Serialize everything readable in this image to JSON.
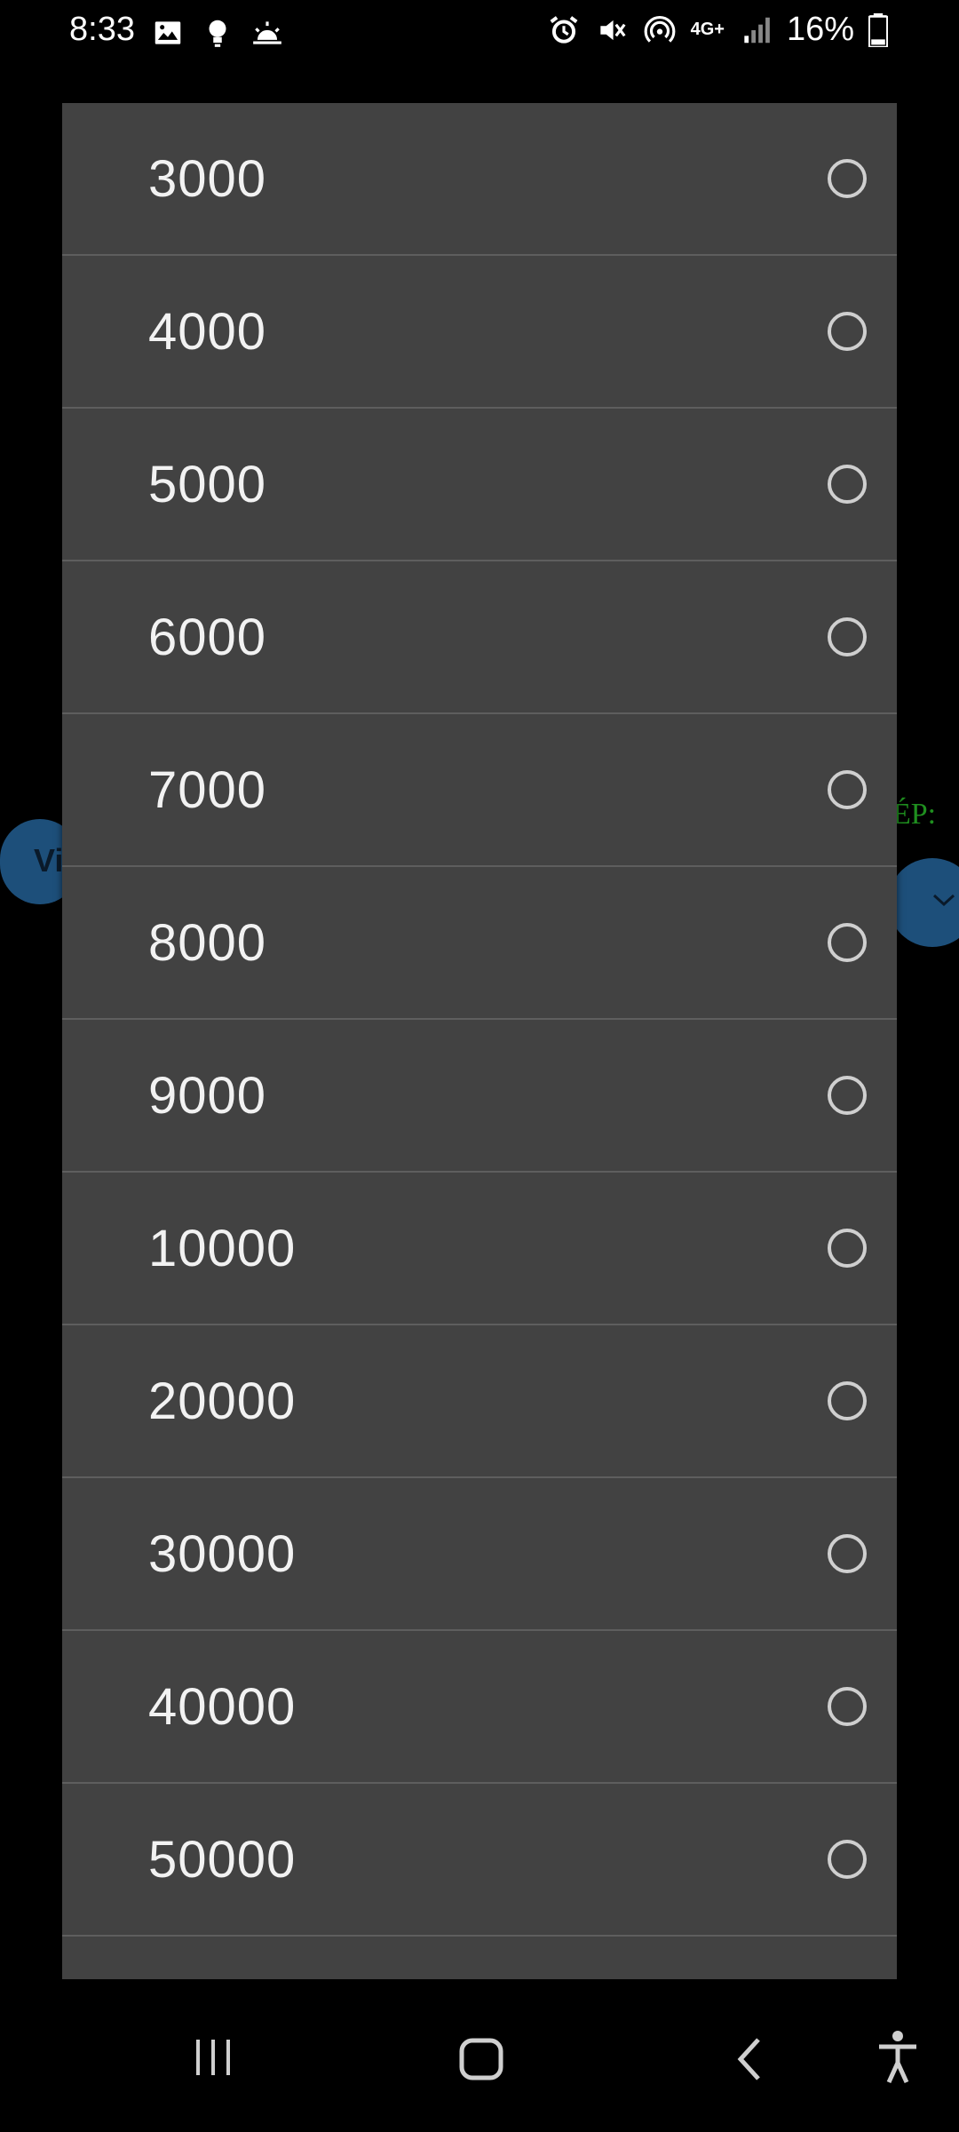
{
  "status_bar": {
    "time": "8:33",
    "left_icons": [
      "image-icon",
      "bulb-icon",
      "sunrise-icon"
    ],
    "right_icons": [
      "alarm-icon",
      "mute-icon",
      "hotspot-icon",
      "network-4g-icon",
      "signal-icon",
      "battery-icon"
    ],
    "network": "4G+",
    "battery": "16%"
  },
  "background": {
    "left_pill_text": "Vi",
    "right_label": "ÉP:"
  },
  "dialog": {
    "options": [
      {
        "label": "3000",
        "selected": false
      },
      {
        "label": "4000",
        "selected": false
      },
      {
        "label": "5000",
        "selected": false
      },
      {
        "label": "6000",
        "selected": false
      },
      {
        "label": "7000",
        "selected": false
      },
      {
        "label": "8000",
        "selected": false
      },
      {
        "label": "9000",
        "selected": false
      },
      {
        "label": "10000",
        "selected": false
      },
      {
        "label": "20000",
        "selected": false
      },
      {
        "label": "30000",
        "selected": false
      },
      {
        "label": "40000",
        "selected": false
      },
      {
        "label": "50000",
        "selected": false
      },
      {
        "label": "",
        "selected": false
      }
    ]
  },
  "nav_bar": {
    "items": [
      "recents-icon",
      "home-icon",
      "back-icon",
      "accessibility-icon"
    ]
  },
  "colors": {
    "dialog_bg": "#424242",
    "divider": "#5e5e5e",
    "radio": "#cfcfcf",
    "background_pill": "#1d4f7a",
    "green_label": "#1f8f1f"
  }
}
